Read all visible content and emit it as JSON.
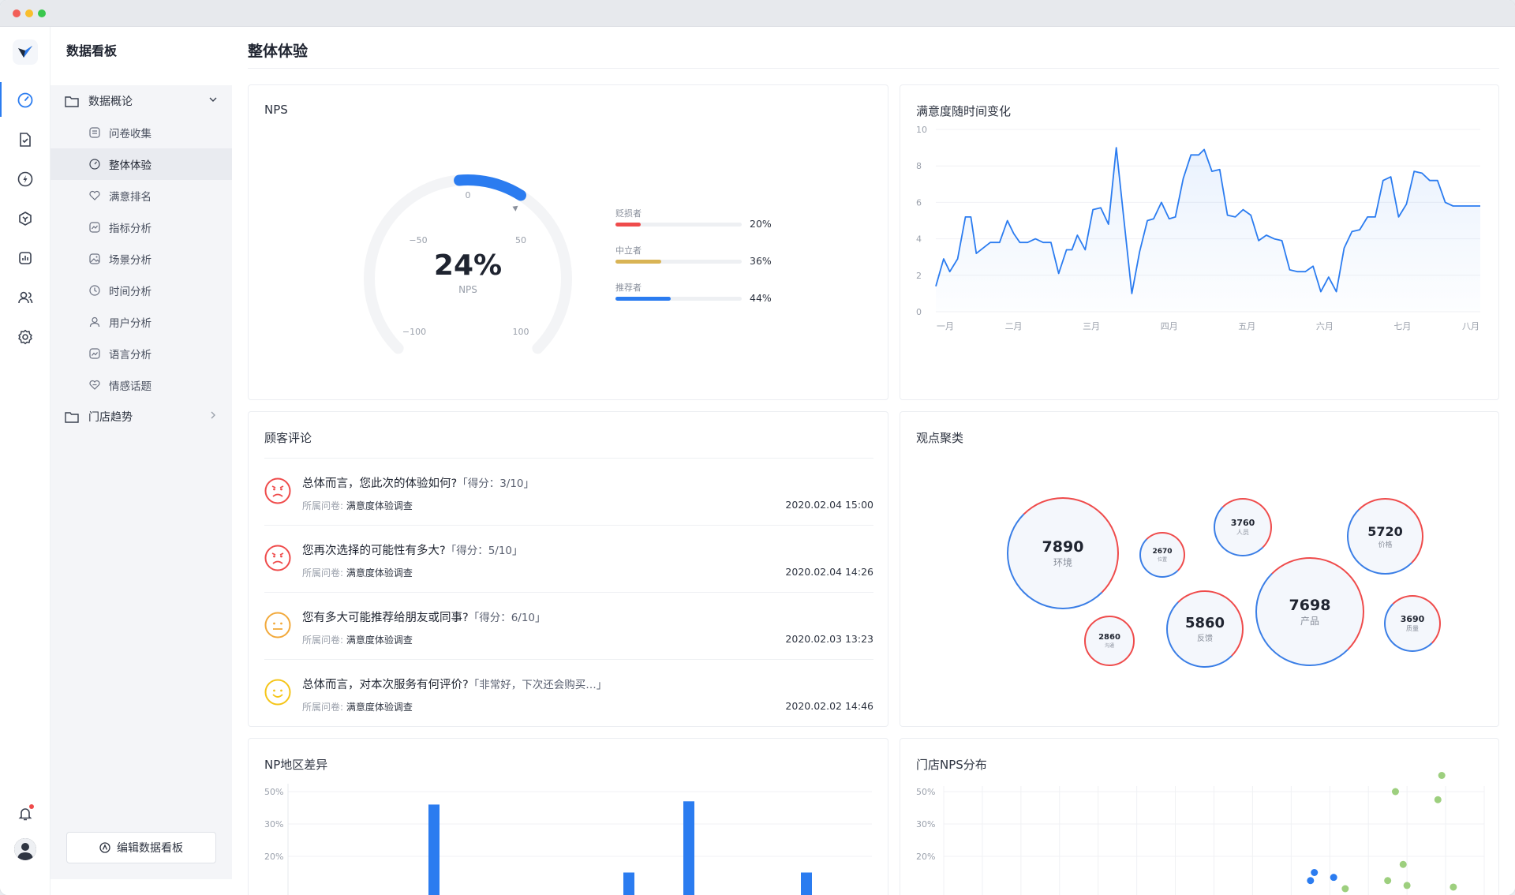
{
  "sidebar": {
    "title": "数据看板",
    "groups": [
      {
        "label": "数据概论",
        "expanded": true
      },
      {
        "label": "门店趋势",
        "expanded": false
      }
    ],
    "items": [
      {
        "label": "问卷收集",
        "icon": "survey-icon"
      },
      {
        "label": "整体体验",
        "icon": "gauge-icon",
        "active": true
      },
      {
        "label": "满意排名",
        "icon": "heart-icon"
      },
      {
        "label": "指标分析",
        "icon": "chart-icon"
      },
      {
        "label": "场景分析",
        "icon": "image-icon"
      },
      {
        "label": "时间分析",
        "icon": "clock-icon"
      },
      {
        "label": "用户分析",
        "icon": "user-icon"
      },
      {
        "label": "语言分析",
        "icon": "language-icon"
      },
      {
        "label": "情感话题",
        "icon": "emotion-icon"
      }
    ],
    "edit_button": "编辑数据看板"
  },
  "page": {
    "title": "整体体验"
  },
  "nps": {
    "title": "NPS",
    "value": "24%",
    "value_label": "NPS",
    "score": 24,
    "ticks": {
      "zero": "0",
      "neg50": "−50",
      "pos50": "50",
      "neg100": "−100",
      "pos100": "100"
    },
    "legend": [
      {
        "name": "贬损者",
        "percent": "20%",
        "value": 0.2,
        "color": "#ef4b4b"
      },
      {
        "name": "中立者",
        "percent": "36%",
        "value": 0.36,
        "color": "#d9b455"
      },
      {
        "name": "推荐者",
        "percent": "44%",
        "value": 0.44,
        "color": "#2b7cf0"
      }
    ],
    "accent": "#2b7cf0"
  },
  "chart_data": [
    {
      "type": "area",
      "title": "满意度随时间变化",
      "categories": [
        "一月",
        "二月",
        "三月",
        "四月",
        "五月",
        "六月",
        "七月",
        "八月"
      ],
      "y_ticks": [
        "0",
        "2",
        "4",
        "6",
        "8",
        "10"
      ],
      "ylim": [
        0,
        10
      ],
      "xlim": [
        0,
        7
      ],
      "x": [
        0,
        0.1,
        0.18,
        0.28,
        0.38,
        0.45,
        0.52,
        0.7,
        0.82,
        0.92,
        1.0,
        1.08,
        1.18,
        1.28,
        1.38,
        1.48,
        1.58,
        1.68,
        1.75,
        1.82,
        1.92,
        2.02,
        2.12,
        2.22,
        2.32,
        2.42,
        2.52,
        2.62,
        2.72,
        2.8,
        2.9,
        3.0,
        3.08,
        3.18,
        3.28,
        3.38,
        3.45,
        3.55,
        3.65,
        3.75,
        3.85,
        3.95,
        4.05,
        4.15,
        4.25,
        4.35,
        4.45,
        4.55,
        4.65,
        4.75,
        4.85,
        4.95,
        5.05,
        5.15,
        5.25,
        5.35,
        5.45,
        5.55,
        5.65,
        5.75,
        5.85,
        5.95,
        6.05,
        6.15,
        6.25,
        6.35,
        6.45,
        6.55,
        6.65,
        6.75,
        6.85,
        6.95,
        7.0
      ],
      "values": [
        1.4,
        2.9,
        2.2,
        2.9,
        5.2,
        5.2,
        3.2,
        3.8,
        3.8,
        5.0,
        4.3,
        3.8,
        3.8,
        4.0,
        3.8,
        3.8,
        2.1,
        3.4,
        3.4,
        4.2,
        3.4,
        5.6,
        5.7,
        4.8,
        9.0,
        5.0,
        1.0,
        3.3,
        5.0,
        5.1,
        6.0,
        5.1,
        5.2,
        7.3,
        8.6,
        8.6,
        8.9,
        7.7,
        7.8,
        5.3,
        5.2,
        5.6,
        5.3,
        3.9,
        4.2,
        4.0,
        3.9,
        2.3,
        2.2,
        2.2,
        2.5,
        1.1,
        1.9,
        1.1,
        3.5,
        4.4,
        4.5,
        5.2,
        5.2,
        7.2,
        7.4,
        5.2,
        5.9,
        7.7,
        7.6,
        7.2,
        7.2,
        6.0,
        5.8,
        5.8,
        5.8,
        5.8,
        5.8
      ],
      "color": "#2b7cf0"
    },
    {
      "type": "bar",
      "title": "NP地区差异",
      "y_ticks": [
        "50%",
        "30%",
        "20%"
      ],
      "x": [
        1.0,
        2.0,
        3.0,
        4.0,
        5.0,
        6.0
      ],
      "values": [
        36,
        0,
        15,
        37,
        0,
        15
      ],
      "color": "#2b7cf0"
    },
    {
      "type": "scatter",
      "title": "门店NPS分布",
      "y_ticks": [
        "50%",
        "30%",
        "20%"
      ],
      "points": [
        {
          "x": 9.5,
          "y": 12.5,
          "color": "#2b7cf0"
        },
        {
          "x": 9.6,
          "y": 15.0,
          "color": "#2b7cf0"
        },
        {
          "x": 10.1,
          "y": 13.5,
          "color": "#2b7cf0"
        },
        {
          "x": 10.4,
          "y": 10.0,
          "color": "#9dcf7e"
        },
        {
          "x": 11.5,
          "y": 12.5,
          "color": "#9dcf7e"
        },
        {
          "x": 11.7,
          "y": 40.0,
          "color": "#9dcf7e"
        },
        {
          "x": 11.9,
          "y": 17.5,
          "color": "#9dcf7e"
        },
        {
          "x": 12.0,
          "y": 11.0,
          "color": "#9dcf7e"
        },
        {
          "x": 12.8,
          "y": 37.5,
          "color": "#9dcf7e"
        },
        {
          "x": 12.9,
          "y": 45.0,
          "color": "#9dcf7e"
        },
        {
          "x": 13.2,
          "y": 10.5,
          "color": "#9dcf7e"
        }
      ]
    }
  ],
  "comments": {
    "title": "顾客评论",
    "meta_label": "所属问卷:",
    "items": [
      {
        "question": "总体而言，您此次的体验如何?",
        "score": "「得分：3/10」",
        "survey": "满意度体验调查",
        "time": "2020.02.04 15:00",
        "sentiment": "negative",
        "color": "#ef4b4b"
      },
      {
        "question": "您再次选择的可能性有多大?",
        "score": "「得分：5/10」",
        "survey": "满意度体验调查",
        "time": "2020.02.04 14:26",
        "sentiment": "negative",
        "color": "#ef4b4b"
      },
      {
        "question": "您有多大可能推荐给朋友或同事?",
        "score": "「得分：6/10」",
        "survey": "满意度体验调查",
        "time": "2020.02.03 13:23",
        "sentiment": "neutral",
        "color": "#f2a93b"
      },
      {
        "question": "总体而言，对本次服务有何评价?",
        "score": "「非常好，下次还会购买…」",
        "survey": "满意度体验调查",
        "time": "2020.02.02 14:46",
        "sentiment": "positive",
        "color": "#f5c518"
      }
    ]
  },
  "clusters": {
    "title": "观点聚类",
    "bubbles": [
      {
        "value": "7890",
        "label": "环境"
      },
      {
        "value": "2670",
        "label": "位置"
      },
      {
        "value": "3760",
        "label": "人员"
      },
      {
        "value": "5720",
        "label": "价格"
      },
      {
        "value": "2860",
        "label": "沟通"
      },
      {
        "value": "5860",
        "label": "反馈"
      },
      {
        "value": "7698",
        "label": "产品"
      },
      {
        "value": "3690",
        "label": "质量"
      }
    ]
  }
}
